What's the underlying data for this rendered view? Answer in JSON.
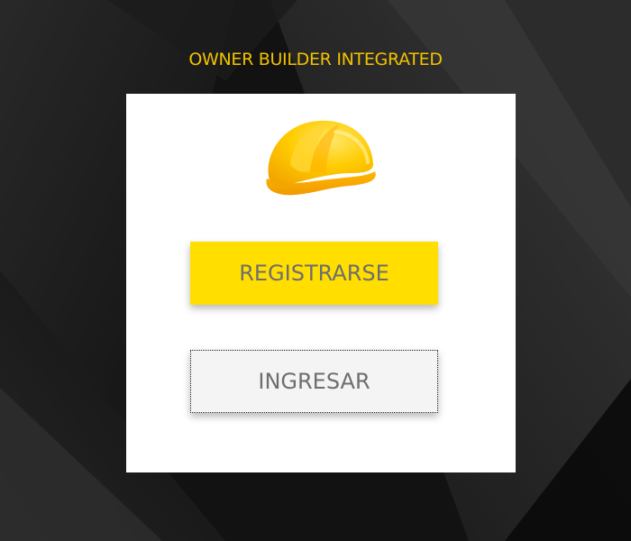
{
  "header": {
    "title": "OWNER BUILDER INTEGRATED"
  },
  "card": {
    "logo_icon": "hard-hat-icon",
    "register_label": "REGISTRARSE",
    "login_label": "INGRESAR"
  },
  "colors": {
    "accent": "#ffde00",
    "title": "#f2c200",
    "background": "#141414",
    "card": "#ffffff",
    "button_text": "#6e6e6e"
  }
}
